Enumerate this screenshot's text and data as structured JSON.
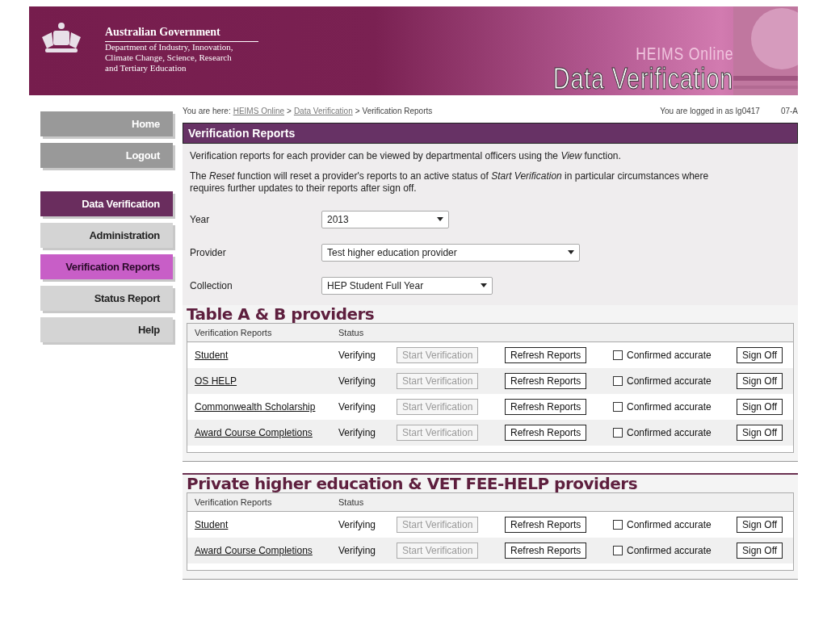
{
  "header": {
    "agency": "Australian Government",
    "department_lines": [
      "Department of Industry, Innovation,",
      "Climate Change, Science, Research",
      "and Tertiary Education"
    ],
    "system": "HEIMS Online",
    "title": "Data Verification"
  },
  "sidebar": {
    "items": [
      {
        "label": "Home",
        "kind": "utility",
        "selected": false
      },
      {
        "label": "Logout",
        "kind": "utility",
        "selected": false
      },
      {
        "label": "Data Verification",
        "kind": "section",
        "selected": false
      },
      {
        "label": "Administration",
        "kind": "sub",
        "selected": false
      },
      {
        "label": "Verification Reports",
        "kind": "sub",
        "selected": true
      },
      {
        "label": "Status Report",
        "kind": "sub",
        "selected": false
      },
      {
        "label": "Help",
        "kind": "sub",
        "selected": false
      }
    ]
  },
  "breadcrumb": {
    "prefix": "You are here:",
    "links": [
      {
        "text": "HEIMS Online",
        "separator": ">"
      },
      {
        "text": "Data Verification",
        "separator": ">"
      }
    ],
    "current": "Verification Reports"
  },
  "user": {
    "logged_in": "You are logged in as lg0417",
    "date": "07-A"
  },
  "panel": {
    "title": "Verification Reports",
    "paragraphs": [
      [
        "Verification reports for each provider can be viewed by departmental officers using the *View* function."
      ],
      [
        "The *Reset* function will reset a provider's reports to an active status of *Start Verification* in particular circumstances where",
        "requires further updates to their reports after sign off."
      ]
    ],
    "fields": [
      {
        "label": "Year",
        "value": "2013"
      },
      {
        "label": "Provider",
        "value": "Test higher education provider"
      },
      {
        "label": "Collection",
        "value": "HEP Student Full Year"
      }
    ]
  },
  "sections": [
    {
      "heading": "Table A & B providers",
      "columns": [
        "Verification Reports",
        "Status"
      ],
      "rows": [
        {
          "report": "Student",
          "status": "Verifying",
          "start": "Start Verification",
          "start_disabled": true,
          "refresh": "Refresh Reports",
          "confirm": "Confirmed accurate",
          "checked": false,
          "sign_off": "Sign Off"
        },
        {
          "report": "OS HELP",
          "status": "Verifying",
          "start": "Start Verification",
          "start_disabled": true,
          "refresh": "Refresh Reports",
          "confirm": "Confirmed accurate",
          "checked": false,
          "sign_off": "Sign Off"
        },
        {
          "report": "Commonwealth Scholarship",
          "status": "Verifying",
          "start": "Start Verification",
          "start_disabled": true,
          "refresh": "Refresh Reports",
          "confirm": "Confirmed accurate",
          "checked": false,
          "sign_off": "Sign Off"
        },
        {
          "report": "Award Course Completions",
          "status": "Verifying",
          "start": "Start Verification",
          "start_disabled": true,
          "refresh": "Refresh Reports",
          "confirm": "Confirmed accurate",
          "checked": false,
          "sign_off": "Sign Off"
        }
      ]
    },
    {
      "heading": "Private higher education & VET FEE-HELP providers",
      "columns": [
        "Verification Reports",
        "Status"
      ],
      "rows": [
        {
          "report": "Student",
          "status": "Verifying",
          "start": "Start Verification",
          "start_disabled": true,
          "refresh": "Refresh Reports",
          "confirm": "Confirmed accurate",
          "checked": false,
          "sign_off": "Sign Off"
        },
        {
          "report": "Award Course Completions",
          "status": "Verifying",
          "start": "Start Verification",
          "start_disabled": true,
          "refresh": "Refresh Reports",
          "confirm": "Confirmed accurate",
          "checked": false,
          "sign_off": "Sign Off"
        }
      ]
    }
  ]
}
